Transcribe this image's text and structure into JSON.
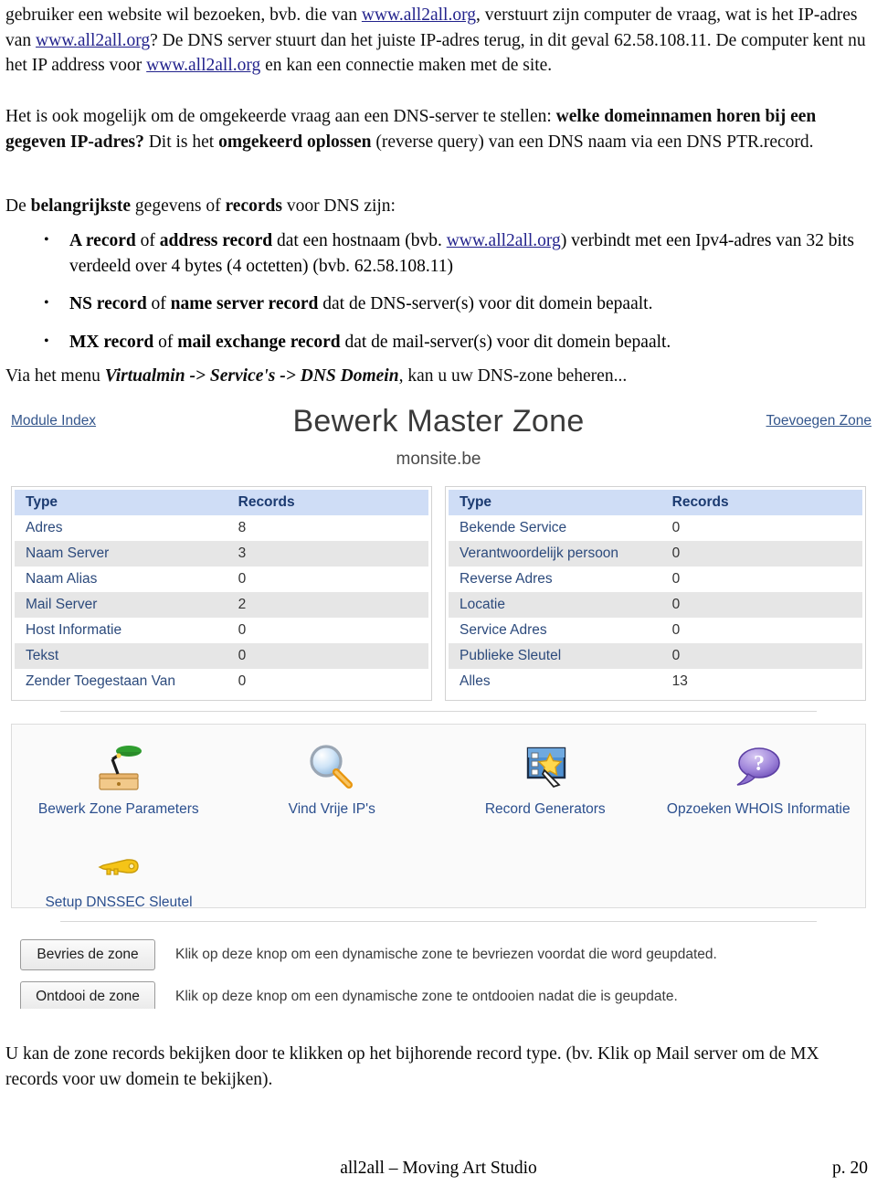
{
  "document": {
    "paragraph_1": {
      "segments": [
        {
          "t": "gebruiker een website wil bezoeken, bvb. die van "
        },
        {
          "t": "www.all2all.org",
          "style": "link"
        },
        {
          "t": ", verstuurt zijn computer de vraag, wat is het IP-adres van "
        },
        {
          "t": "www.all2all.org",
          "style": "link"
        },
        {
          "t": "? De DNS server stuurt dan het juiste IP-adres terug, in dit geval 62.58.108.11. De computer kent nu het IP address voor "
        },
        {
          "t": "www.all2all.org",
          "style": "link"
        },
        {
          "t": " en kan een connectie maken met de site."
        }
      ]
    },
    "paragraph_2": {
      "segments": [
        {
          "t": "Het is ook mogelijk om de omgekeerde vraag aan een DNS-server te stellen: "
        },
        {
          "t": "welke domeinnamen horen bij een gegeven IP-adres?",
          "style": "bold"
        },
        {
          "t": " Dit is het "
        },
        {
          "t": "omgekeerd oplossen",
          "style": "bold"
        },
        {
          "t": " (reverse query) van een DNS naam via een DNS PTR.record."
        }
      ]
    },
    "paragraph_3": {
      "segments": [
        {
          "t": "De "
        },
        {
          "t": "belangrijkste",
          "style": "bold"
        },
        {
          "t": " gegevens of "
        },
        {
          "t": "records",
          "style": "bold"
        },
        {
          "t": " voor DNS zijn:"
        }
      ]
    },
    "bullets": [
      {
        "segments": [
          {
            "t": "A record",
            "style": "bold"
          },
          {
            "t": " of "
          },
          {
            "t": "address record",
            "style": "bold"
          },
          {
            "t": " dat een hostnaam (bvb. "
          },
          {
            "t": "www.all2all.org",
            "style": "link"
          },
          {
            "t": ") verbindt met een Ipv4-adres van 32 bits verdeeld over 4 bytes (4 octetten) (bvb. 62.58.108.11)"
          }
        ]
      },
      {
        "segments": [
          {
            "t": "NS record",
            "style": "bold"
          },
          {
            "t": " of "
          },
          {
            "t": "name server record",
            "style": "bold"
          },
          {
            "t": " dat de DNS-server(s) voor dit domein bepaalt."
          }
        ]
      },
      {
        "segments": [
          {
            "t": "MX record",
            "style": "bold"
          },
          {
            "t": " of "
          },
          {
            "t": "mail exchange record",
            "style": "bold"
          },
          {
            "t": " dat de mail-server(s) voor dit domein bepaalt."
          }
        ]
      }
    ],
    "paragraph_4": {
      "segments": [
        {
          "t": "Via het menu "
        },
        {
          "t": "Virtualmin -> Service's -> DNS Domein",
          "style": "bolditalic"
        },
        {
          "t": ", kan u uw DNS-zone beheren..."
        }
      ]
    },
    "paragraph_5": {
      "segments": [
        {
          "t": "U kan de zone records bekijken door te klikken op het bijhorende record type. (bv. Klik op Mail server om de MX records voor uw domein te bekijken)."
        }
      ]
    },
    "footer": {
      "center": "all2all – Moving Art Studio",
      "page": "p. 20"
    }
  },
  "screenshot": {
    "nav": {
      "module_index": "Module Index",
      "add_zone": "Toevoegen Zone"
    },
    "title": "Bewerk Master Zone",
    "subtitle": "monsite.be",
    "tables": [
      {
        "headers": [
          "Type",
          "Records"
        ],
        "rows": [
          [
            "Adres",
            "8"
          ],
          [
            "Naam Server",
            "3"
          ],
          [
            "Naam Alias",
            "0"
          ],
          [
            "Mail Server",
            "2"
          ],
          [
            "Host Informatie",
            "0"
          ],
          [
            "Tekst",
            "0"
          ],
          [
            "Zender Toegestaan Van",
            "0"
          ]
        ]
      },
      {
        "headers": [
          "Type",
          "Records"
        ],
        "rows": [
          [
            "Bekende Service",
            "0"
          ],
          [
            "Verantwoordelijk persoon",
            "0"
          ],
          [
            "Reverse Adres",
            "0"
          ],
          [
            "Locatie",
            "0"
          ],
          [
            "Service Adres",
            "0"
          ],
          [
            "Publieke Sleutel",
            "0"
          ],
          [
            "Alles",
            "13"
          ]
        ]
      }
    ],
    "icons": [
      {
        "label": "Bewerk Zone Parameters",
        "icon": "desk-lamp-icon"
      },
      {
        "label": "Vind Vrije IP's",
        "icon": "magnifier-icon"
      },
      {
        "label": "Record Generators",
        "icon": "wizard-wand-icon"
      },
      {
        "label": "Opzoeken WHOIS Informatie",
        "icon": "question-balloon-icon"
      },
      {
        "label": "Setup DNSSEC Sleutel",
        "icon": "key-icon"
      }
    ],
    "buttons": [
      {
        "label": "Bevries de zone",
        "description": "Klik op deze knop om een dynamische zone te bevriezen voordat die word geupdated."
      },
      {
        "label": "Ontdooi de zone",
        "description": "Klik op deze knop om een dynamische zone te ontdooien nadat die is geupdate."
      }
    ],
    "colors": {
      "header_bg": "#cfddf6",
      "link": "#34568c",
      "row_alt": "#e6e6e6"
    }
  }
}
